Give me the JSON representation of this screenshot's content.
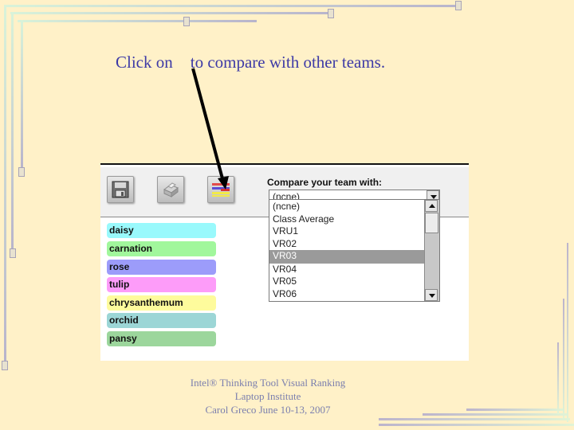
{
  "headline": {
    "before": "Click on",
    "after": "to compare with other teams."
  },
  "toolbar": {
    "buttons": [
      {
        "name": "save",
        "icon": "floppy-disk-icon"
      },
      {
        "name": "print",
        "icon": "printer-icon"
      },
      {
        "name": "compare",
        "icon": "compare-bars-icon",
        "colors": [
          "#d94040",
          "#5a4ad6",
          "#f0e040"
        ]
      }
    ]
  },
  "compare": {
    "label": "Compare your team with:",
    "selected": "(ncne)",
    "options": [
      "(ncne)",
      "Class Average",
      "VRU1",
      "VR02",
      "VR03",
      "VR04",
      "VR05",
      "VR06"
    ],
    "highlighted_index": 4
  },
  "ranking_items": [
    {
      "label": "daisy",
      "color": "#99f9fc"
    },
    {
      "label": "carnation",
      "color": "#a1f79c"
    },
    {
      "label": "rose",
      "color": "#9c9cfa"
    },
    {
      "label": "tulip",
      "color": "#fd9cf9"
    },
    {
      "label": "chrysanthemum",
      "color": "#fefb9c"
    },
    {
      "label": "orchid",
      "color": "#9cd6d6"
    },
    {
      "label": "pansy",
      "color": "#9cd69c"
    }
  ],
  "footer": {
    "line1": "Intel® Thinking Tool Visual Ranking",
    "line2": "Laptop Institute",
    "line3": "Carol Greco June 10-13, 2007"
  }
}
